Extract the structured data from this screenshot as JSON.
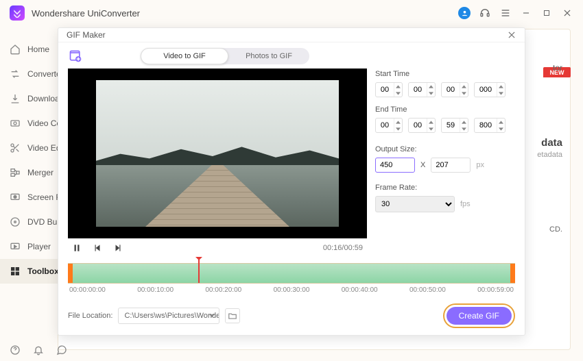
{
  "app": {
    "title": "Wondershare UniConverter"
  },
  "titlebar_icons": [
    "avatar",
    "headset",
    "menu",
    "minimize",
    "maximize",
    "close"
  ],
  "sidebar": {
    "items": [
      {
        "label": "Home",
        "icon": "home"
      },
      {
        "label": "Converter",
        "icon": "converter"
      },
      {
        "label": "Downloader",
        "icon": "download"
      },
      {
        "label": "Video Compressor",
        "icon": "compressor"
      },
      {
        "label": "Video Editor",
        "icon": "scissors"
      },
      {
        "label": "Merger",
        "icon": "merger"
      },
      {
        "label": "Screen Recorder",
        "icon": "recorder"
      },
      {
        "label": "DVD Burner",
        "icon": "dvd"
      },
      {
        "label": "Player",
        "icon": "player"
      },
      {
        "label": "Toolbox",
        "icon": "toolbox"
      }
    ],
    "active_index": 9
  },
  "background": {
    "new_badge": "NEW",
    "line1_suffix": "tor",
    "line2": "data",
    "line3": "etadata",
    "line4": "CD."
  },
  "dialog": {
    "title": "GIF Maker",
    "tabs": [
      "Video to GIF",
      "Photos to GIF"
    ],
    "tab_selected": 0,
    "playback": {
      "current": "00:16",
      "total": "00:59"
    },
    "start_label": "Start Time",
    "start": [
      "00",
      "00",
      "00",
      "000"
    ],
    "end_label": "End Time",
    "end": [
      "00",
      "00",
      "59",
      "800"
    ],
    "output_label": "Output Size:",
    "output_w": "450",
    "output_h": "207",
    "output_x": "X",
    "output_unit": "px",
    "frame_label": "Frame Rate:",
    "frame_rate": "30",
    "frame_unit": "fps",
    "ticks": [
      "00:00:00:00",
      "00:00:10:00",
      "00:00:20:00",
      "00:00:30:00",
      "00:00:40:00",
      "00:00:50:00",
      "00:00:59:00"
    ],
    "file_loc_label": "File Location:",
    "file_loc_value": "C:\\Users\\ws\\Pictures\\Wonders",
    "create_label": "Create GIF"
  }
}
